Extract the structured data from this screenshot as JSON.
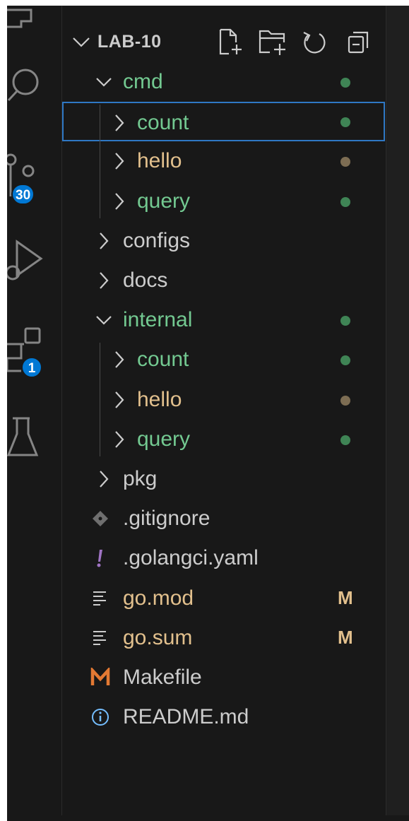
{
  "colors": {
    "background": "#181818",
    "text_default": "#cccccc",
    "git_untracked": "#73c991",
    "git_modified": "#e2c08d",
    "dot_green": "#3f8455",
    "dot_brown": "#7d6d53",
    "badge": "#0078d4",
    "selection_border": "#2f78c4"
  },
  "activity_bar": {
    "items": [
      {
        "name": "explorer-icon",
        "badge": ""
      },
      {
        "name": "search-icon",
        "badge": ""
      },
      {
        "name": "source-control-icon",
        "badge": "30"
      },
      {
        "name": "run-debug-icon",
        "badge": ""
      },
      {
        "name": "extensions-icon",
        "badge": "1"
      },
      {
        "name": "testing-icon",
        "badge": ""
      }
    ]
  },
  "explorer": {
    "folder_title": "LAB-10",
    "actions": [
      "new-file-icon",
      "new-folder-icon",
      "refresh-icon",
      "collapse-all-icon"
    ],
    "tree": [
      {
        "label": "cmd",
        "kind": "folder",
        "expanded": true,
        "depth": 0,
        "color": "#73c991",
        "dot": "#3f8455"
      },
      {
        "label": "count",
        "kind": "folder",
        "expanded": false,
        "depth": 1,
        "color": "#73c991",
        "dot": "#3f8455",
        "selected": true
      },
      {
        "label": "hello",
        "kind": "folder",
        "expanded": false,
        "depth": 1,
        "color": "#e2c08d",
        "dot": "#7d6d53"
      },
      {
        "label": "query",
        "kind": "folder",
        "expanded": false,
        "depth": 1,
        "color": "#73c991",
        "dot": "#3f8455"
      },
      {
        "label": "configs",
        "kind": "folder",
        "expanded": false,
        "depth": 0,
        "color": "#cccccc"
      },
      {
        "label": "docs",
        "kind": "folder",
        "expanded": false,
        "depth": 0,
        "color": "#cccccc"
      },
      {
        "label": "internal",
        "kind": "folder",
        "expanded": true,
        "depth": 0,
        "color": "#73c991",
        "dot": "#3f8455"
      },
      {
        "label": "count",
        "kind": "folder",
        "expanded": false,
        "depth": 1,
        "color": "#73c991",
        "dot": "#3f8455"
      },
      {
        "label": "hello",
        "kind": "folder",
        "expanded": false,
        "depth": 1,
        "color": "#e2c08d",
        "dot": "#7d6d53"
      },
      {
        "label": "query",
        "kind": "folder",
        "expanded": false,
        "depth": 1,
        "color": "#73c991",
        "dot": "#3f8455"
      },
      {
        "label": "pkg",
        "kind": "folder",
        "expanded": false,
        "depth": 0,
        "color": "#cccccc"
      },
      {
        "label": ".gitignore",
        "kind": "file",
        "icon": "git-diamond-icon",
        "color": "#cccccc"
      },
      {
        "label": ".golangci.yaml",
        "kind": "file",
        "icon": "yaml-exclamation-icon",
        "color": "#cccccc"
      },
      {
        "label": "go.mod",
        "kind": "file",
        "icon": "lines-icon",
        "color": "#e2c08d",
        "status": "M"
      },
      {
        "label": "go.sum",
        "kind": "file",
        "icon": "lines-icon",
        "color": "#e2c08d",
        "status": "M"
      },
      {
        "label": "Makefile",
        "kind": "file",
        "icon": "makefile-m-icon",
        "color": "#cccccc"
      },
      {
        "label": "README.md",
        "kind": "file",
        "icon": "info-icon",
        "color": "#cccccc"
      }
    ]
  }
}
